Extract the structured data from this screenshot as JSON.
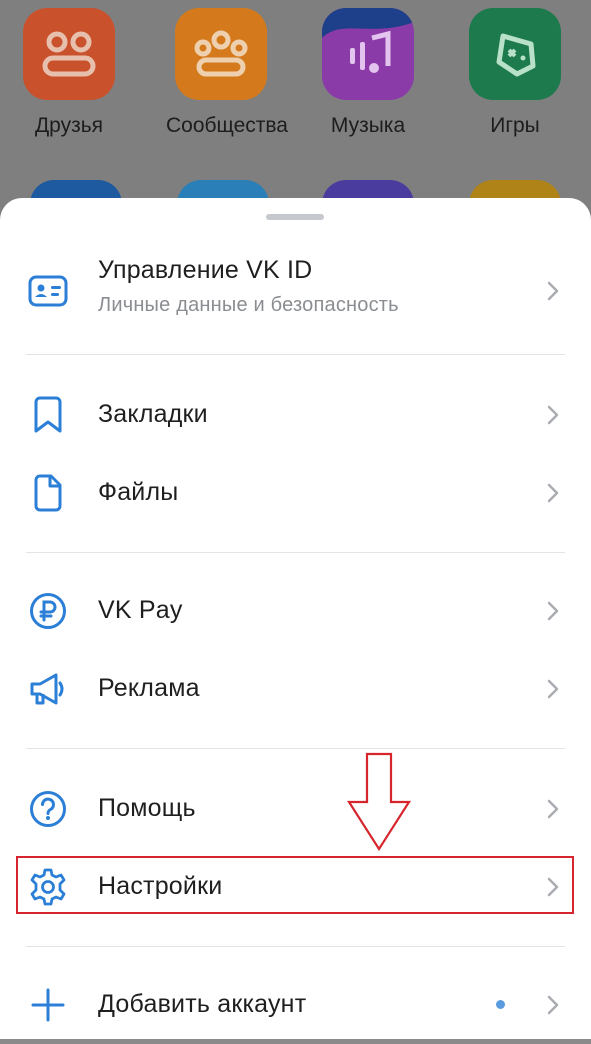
{
  "apps": [
    {
      "label": "Друзья",
      "color": "#c9522d",
      "icon": "friends-icon"
    },
    {
      "label": "Сообщества",
      "color": "#d47a1c",
      "icon": "communities-icon"
    },
    {
      "label": "Музыка",
      "color": "#8a3ba8",
      "icon": "music-icon"
    },
    {
      "label": "Игры",
      "color": "#1d7a4c",
      "icon": "games-icon"
    }
  ],
  "row2_colors": [
    "#1e5aa0",
    "#2a7fb8",
    "#4a3c9e",
    "#b08318"
  ],
  "menu": {
    "vkid": {
      "title": "Управление VK ID",
      "subtitle": "Личные данные и безопасность",
      "icon": "id-card-icon"
    },
    "bookmarks": {
      "title": "Закладки",
      "icon": "bookmark-icon"
    },
    "files": {
      "title": "Файлы",
      "icon": "file-icon"
    },
    "vkpay": {
      "title": "VK Pay",
      "icon": "ruble-icon"
    },
    "ads": {
      "title": "Реклама",
      "icon": "megaphone-icon"
    },
    "help": {
      "title": "Помощь",
      "icon": "question-icon"
    },
    "settings": {
      "title": "Настройки",
      "icon": "gear-icon"
    },
    "add_account": {
      "title": "Добавить аккаунт",
      "icon": "plus-icon"
    }
  },
  "colors": {
    "accent": "#2b7fd6",
    "highlight": "#d7252e"
  }
}
